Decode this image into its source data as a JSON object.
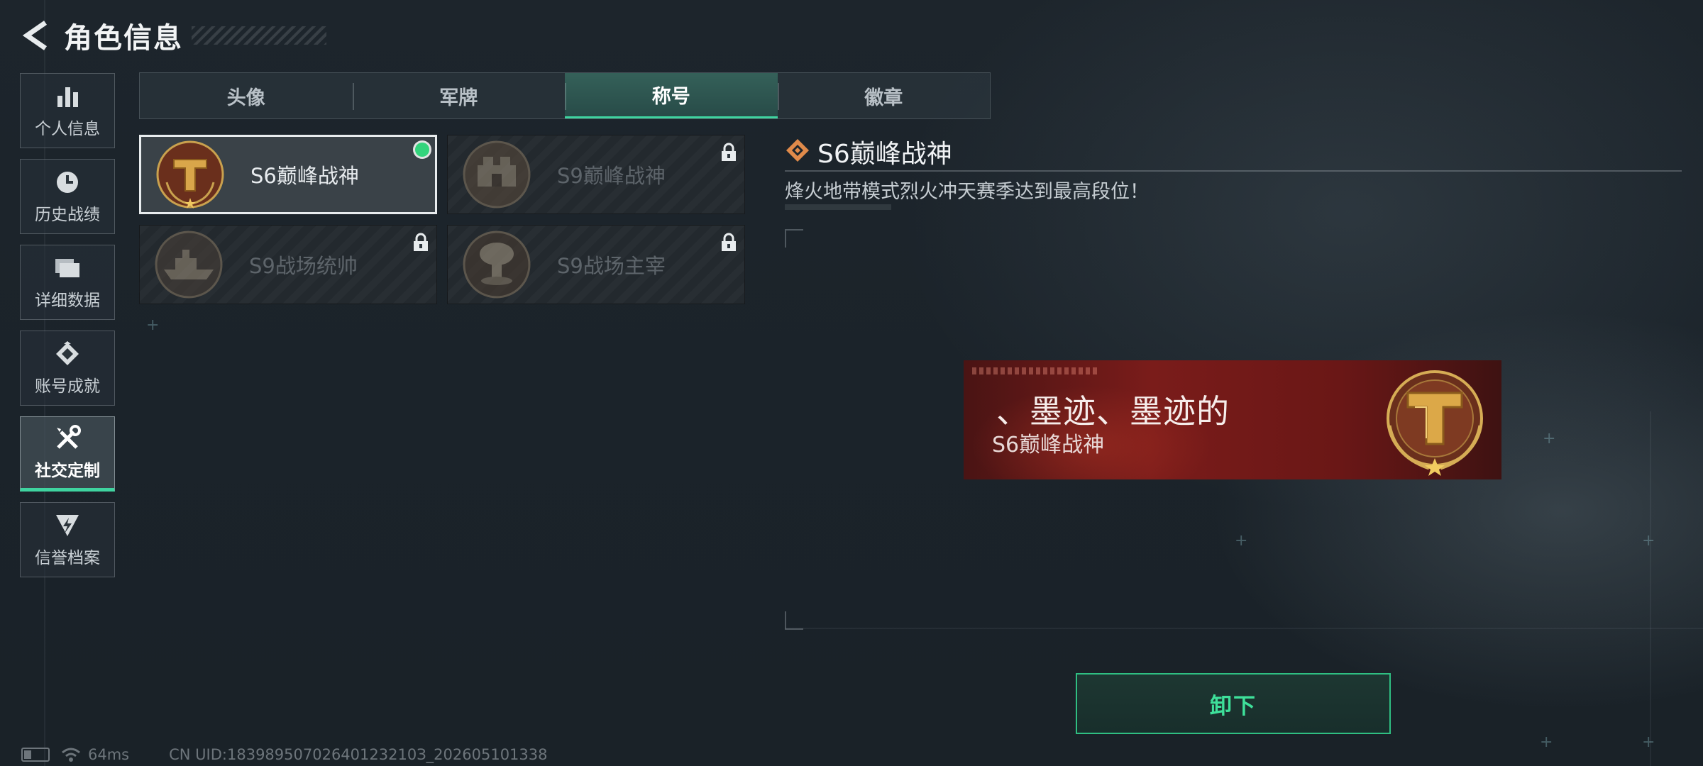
{
  "header": {
    "title": "角色信息",
    "back_icon": "chevron-left-icon"
  },
  "sidebar": {
    "items": [
      {
        "label": "个人信息",
        "icon": "bar-chart-icon",
        "active": false
      },
      {
        "label": "历史战绩",
        "icon": "clock-icon",
        "active": false
      },
      {
        "label": "详细数据",
        "icon": "folder-icon",
        "active": false
      },
      {
        "label": "账号成就",
        "icon": "achievement-icon",
        "active": false
      },
      {
        "label": "社交定制",
        "icon": "tools-icon",
        "active": true
      },
      {
        "label": "信誉档案",
        "icon": "reputation-icon",
        "active": false
      }
    ]
  },
  "tabs": [
    {
      "label": "头像",
      "active": false
    },
    {
      "label": "军牌",
      "active": false
    },
    {
      "label": "称号",
      "active": true
    },
    {
      "label": "徽章",
      "active": false
    }
  ],
  "titles": [
    {
      "name": "S6巅峰战神",
      "emblem": "gold-t-emblem-icon",
      "selected": true,
      "equipped": true,
      "locked": false
    },
    {
      "name": "S9巅峰战神",
      "emblem": "fortress-emblem-icon",
      "selected": false,
      "equipped": false,
      "locked": true
    },
    {
      "name": "S9战场统帅",
      "emblem": "warship-emblem-icon",
      "selected": false,
      "equipped": false,
      "locked": true
    },
    {
      "name": "S9战场主宰",
      "emblem": "mushroom-cloud-emblem-icon",
      "selected": false,
      "equipped": false,
      "locked": true
    }
  ],
  "detail": {
    "icon": "diamond-icon",
    "title": "S6巅峰战神",
    "description": "烽火地带模式烈火冲天赛季达到最高段位！"
  },
  "banner": {
    "player_name": "、墨迹、墨迹的",
    "title": "S6巅峰战神",
    "emblem": "gold-t-emblem-icon"
  },
  "actions": {
    "unequip_label": "卸下"
  },
  "status_bar": {
    "ping": "64ms",
    "uid": "CN UID:18398950702640123210З_202605101338"
  },
  "colors": {
    "accent": "#3fd4a0",
    "banner_red": "#7a1c1a",
    "equipped_dot": "#33d47c"
  }
}
